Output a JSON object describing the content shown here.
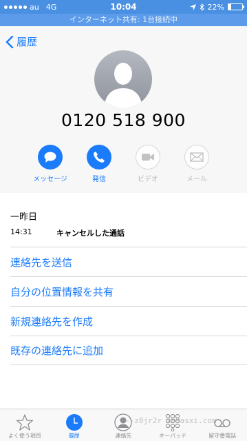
{
  "status": {
    "carrier": "au",
    "network": "4G",
    "time": "10:04",
    "battery": "22%",
    "battery_level": 0.22
  },
  "hotspot": "インターネット共有: 1台接続中",
  "nav": {
    "back_label": "履歴"
  },
  "contact": {
    "phone_number": "0120 518 900"
  },
  "actions": [
    {
      "label": "メッセージ",
      "icon": "message-icon",
      "enabled": true
    },
    {
      "label": "発信",
      "icon": "phone-icon",
      "enabled": true
    },
    {
      "label": "ビデオ",
      "icon": "video-icon",
      "enabled": false
    },
    {
      "label": "メール",
      "icon": "mail-icon",
      "enabled": false
    }
  ],
  "history": {
    "date": "一昨日",
    "time": "14:31",
    "status": "キャンセルした通話"
  },
  "options": [
    "連絡先を送信",
    "自分の位置情報を共有",
    "新規連絡先を作成",
    "既存の連絡先に追加"
  ],
  "tabs": [
    {
      "label": "よく使う項目",
      "icon": "star-icon",
      "active": false
    },
    {
      "label": "履歴",
      "icon": "clock-icon",
      "active": true
    },
    {
      "label": "連絡先",
      "icon": "contact-icon",
      "active": false
    },
    {
      "label": "キーパッド",
      "icon": "keypad-icon",
      "active": false
    },
    {
      "label": "留守番電話",
      "icon": "voicemail-icon",
      "active": false
    }
  ],
  "watermark": "--z8jr2r 289asxi.com",
  "colors": {
    "accent": "#1a7bfb",
    "status_bar": "#4a90e2"
  }
}
